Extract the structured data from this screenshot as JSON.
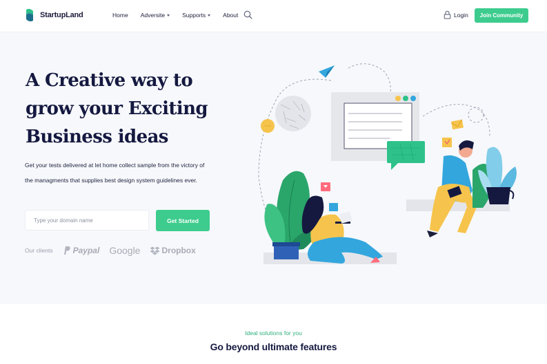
{
  "brand": {
    "name": "StartupLand",
    "logo_icon": "startupland-logo-icon",
    "accent": "#3dcc8e"
  },
  "nav": {
    "items": [
      {
        "label": "Home",
        "dropdown": false
      },
      {
        "label": "Adversite",
        "dropdown": true
      },
      {
        "label": "Supports",
        "dropdown": true
      },
      {
        "label": "About",
        "dropdown": false
      }
    ],
    "search_icon": "search-icon",
    "login_label": "Login",
    "join_label": "Join Community"
  },
  "hero": {
    "title": "A Creative way to grow your Exciting Business ideas",
    "description": "Get your tests delivered at let home collect sample from the victory of the managments that supplies best design system guidelines ever.",
    "input_placeholder": "Type your domain name",
    "input_value": "",
    "cta_label": "Get Started",
    "clients_label": "Our clients",
    "clients": [
      "Paypal",
      "Google",
      "Dropbox"
    ]
  },
  "features": {
    "kicker": "Ideal solutions for you",
    "title": "Go beyond ultimate features"
  }
}
